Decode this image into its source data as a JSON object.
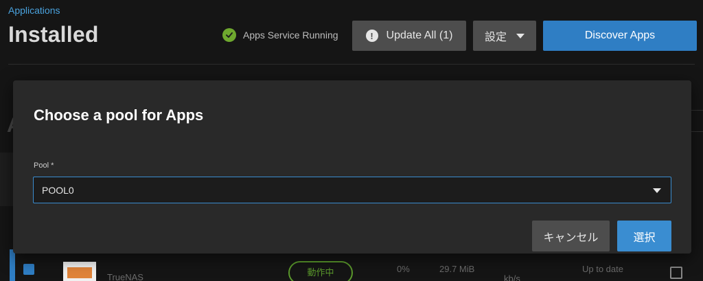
{
  "header": {
    "breadcrumb": "Applications",
    "title": "Installed",
    "status_text": "Apps Service Running",
    "update_all_label": "Update All (1)",
    "settings_label": "設定",
    "discover_label": "Discover Apps"
  },
  "background": {
    "partial_heading": "A",
    "app_name_partial": "TrueNAS",
    "state_partial": "動作中",
    "cpu_partial": "0%",
    "mem_partial": "29.7 MiB",
    "net_partial": "kb/s",
    "update_partial": "Up to date"
  },
  "dialog": {
    "title": "Choose a pool for Apps",
    "field_label": "Pool *",
    "selected_pool": "POOL0",
    "cancel_label": "キャンセル",
    "select_label": "選択"
  },
  "colors": {
    "accent": "#3a8dd1",
    "status_ok": "#6ea82e",
    "background": "#151515",
    "dialog_bg": "#292929"
  },
  "icons": {
    "status": "check-circle-icon",
    "update": "alert-circle-icon",
    "dropdown": "chevron-down-icon"
  }
}
